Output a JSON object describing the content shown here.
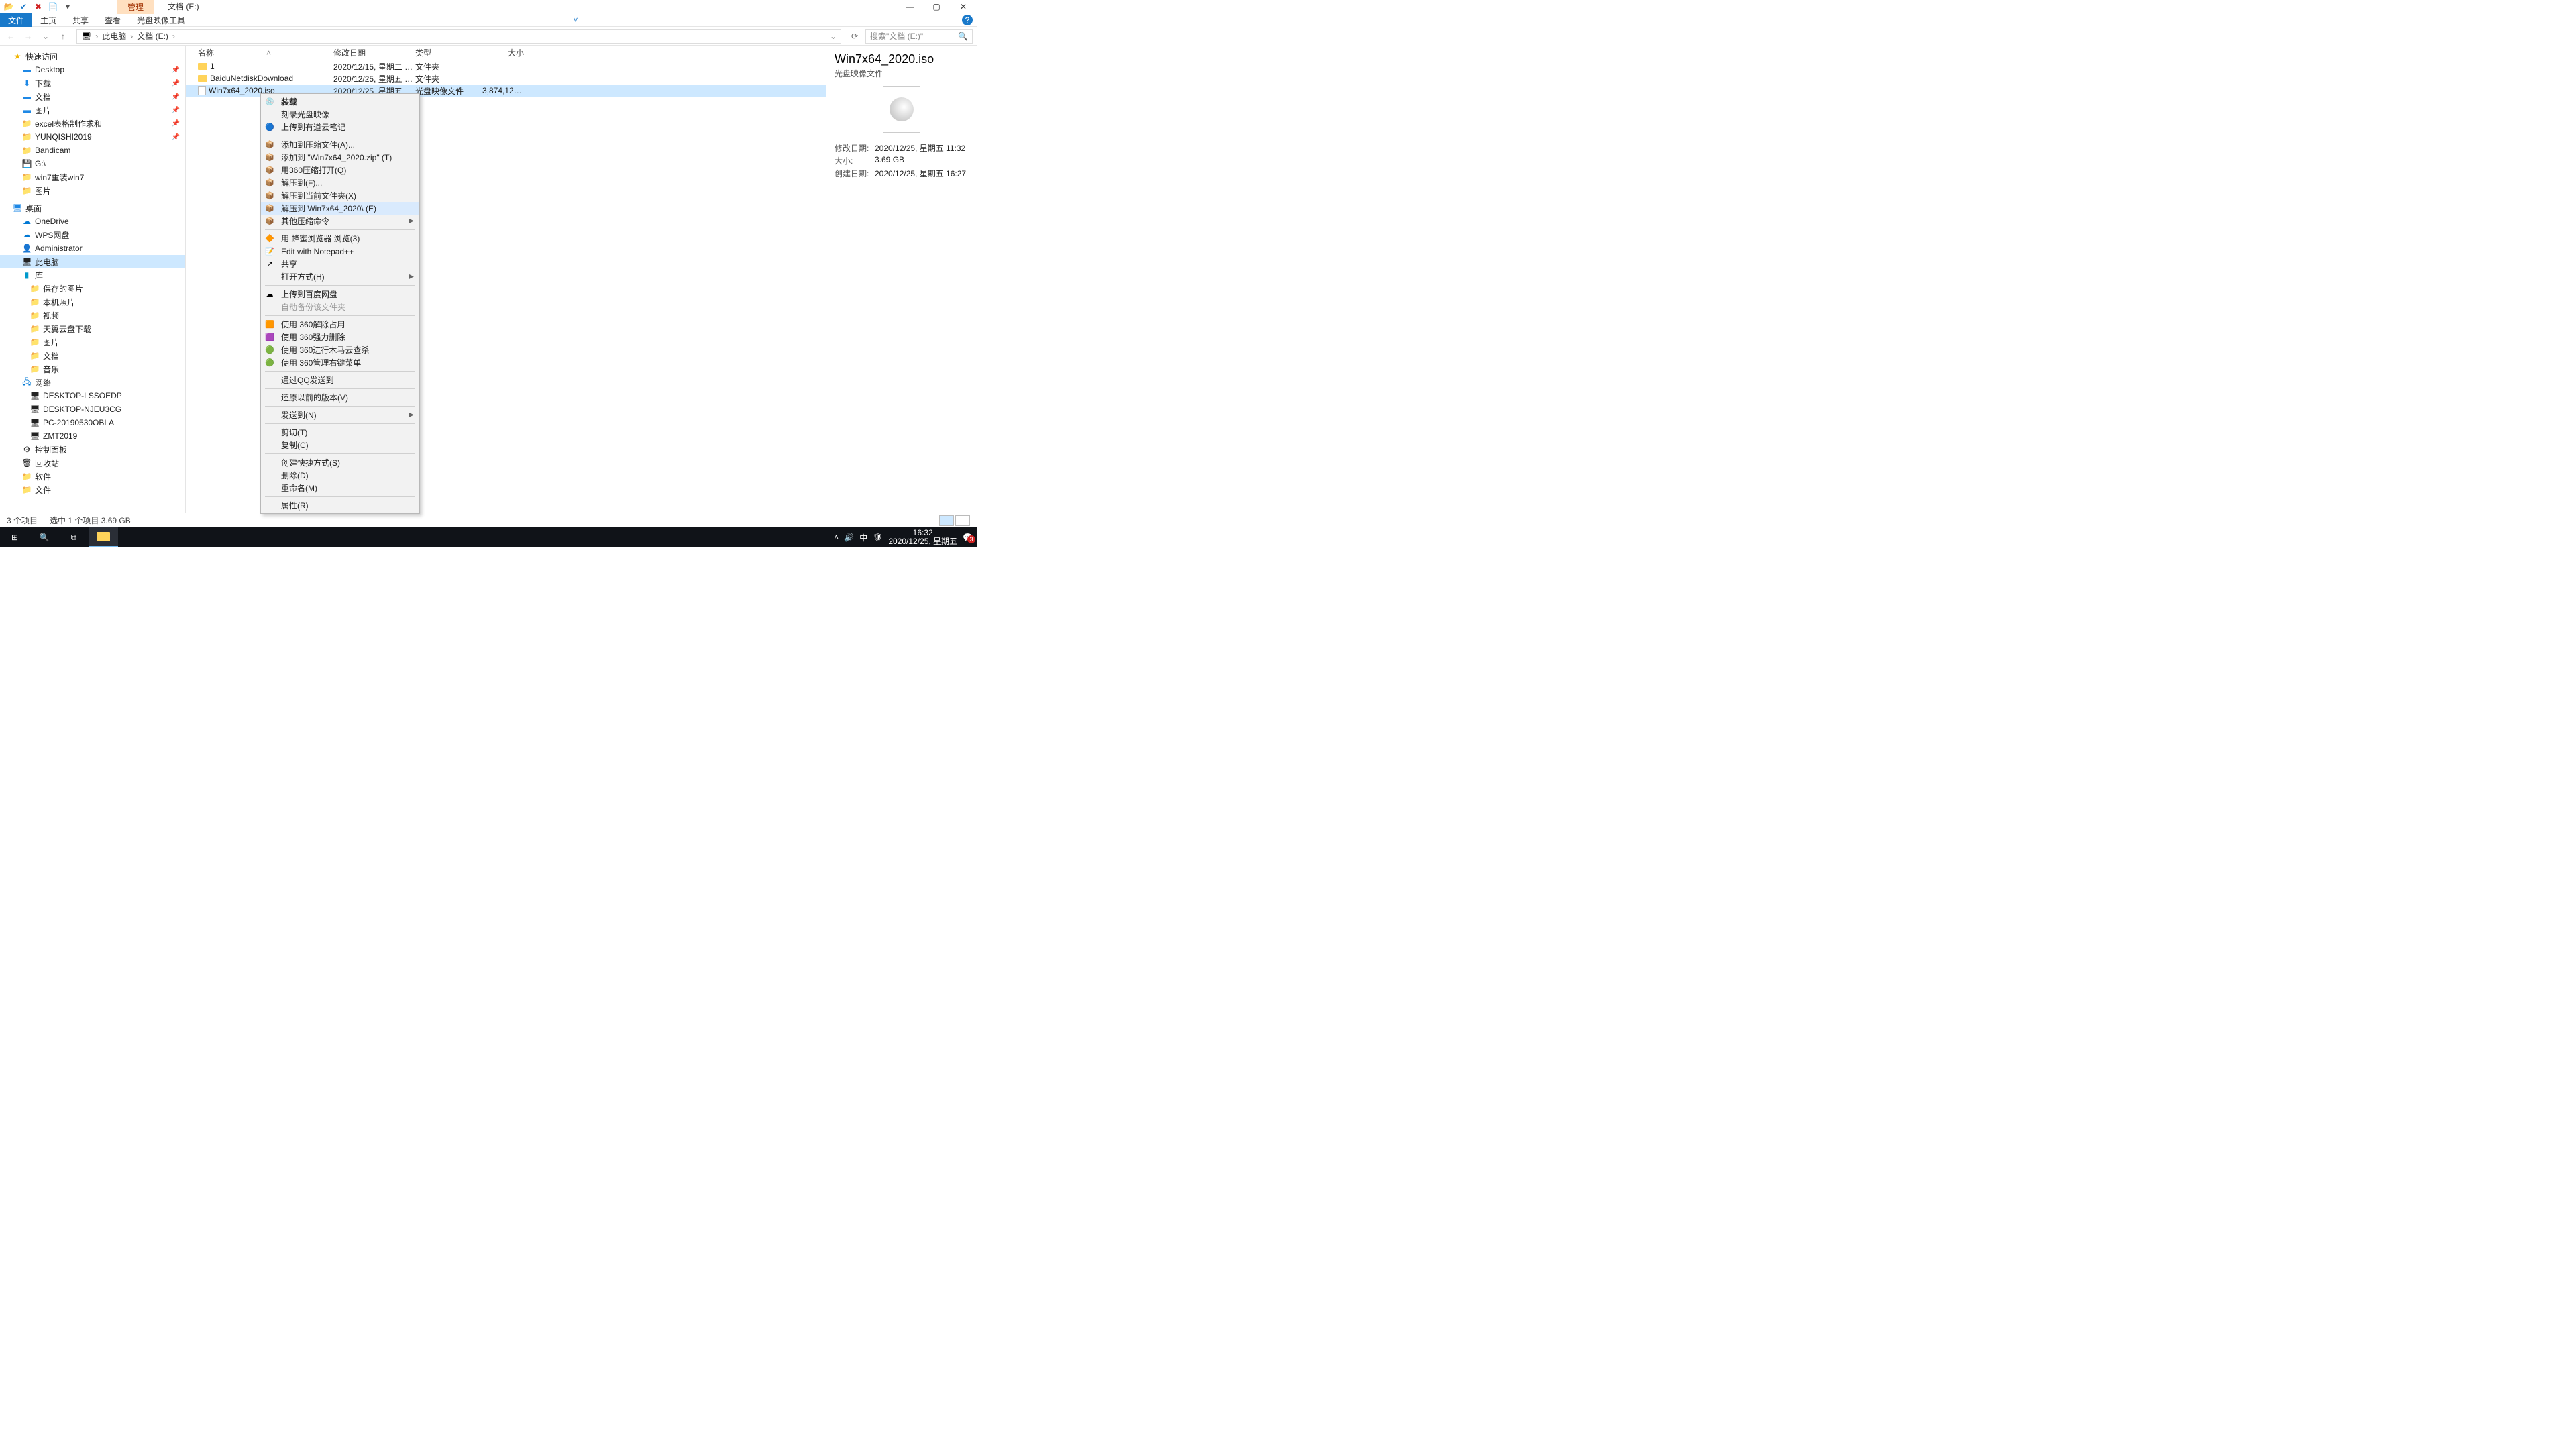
{
  "title_tab_manage": "管理",
  "window_title": "文档 (E:)",
  "qat": {
    "open": "📂",
    "check": "✔",
    "close": "✖",
    "new": "📄",
    "dropdown": "▾"
  },
  "ribbon": {
    "file": "文件",
    "home": "主页",
    "share": "共享",
    "view": "查看",
    "iso_tool": "光盘映像工具"
  },
  "win": {
    "min": "—",
    "max": "▢",
    "close": "✕",
    "help": "?"
  },
  "addr": {
    "back": "←",
    "forward": "→",
    "up": "↑",
    "recent": "⌄",
    "pc_icon": "🖥",
    "this_pc": "此电脑",
    "drive": "文档 (E:)",
    "sep": "›",
    "refresh": "⟳",
    "search_placeholder": "搜索\"文档 (E:)\"",
    "search_icon": "🔍",
    "history": "⌄"
  },
  "headers": {
    "name": "名称",
    "date": "修改日期",
    "type": "类型",
    "size": "大小",
    "sort": "˄"
  },
  "rows": [
    {
      "name": "1",
      "date": "2020/12/15, 星期二 1...",
      "type": "文件夹",
      "size": "",
      "kind": "folder"
    },
    {
      "name": "BaiduNetdiskDownload",
      "date": "2020/12/25, 星期五 1...",
      "type": "文件夹",
      "size": "",
      "kind": "folder"
    },
    {
      "name": "Win7x64_2020.iso",
      "date": "2020/12/25, 星期五 1...",
      "type": "光盘映像文件",
      "size": "3,874,126...",
      "kind": "file"
    }
  ],
  "tree": {
    "quick": "快速访问",
    "desktop": "Desktop",
    "download": "下载",
    "docs": "文档",
    "pics": "图片",
    "excel": "excel表格制作求和",
    "yunqishi": "YUNQISHI2019",
    "bandicam": "Bandicam",
    "gdrive": "G:\\",
    "win7": "win7重装win7",
    "pics2": "图片",
    "desk_root": "桌面",
    "onedrive": "OneDrive",
    "wps": "WPS网盘",
    "admin": "Administrator",
    "this_pc": "此电脑",
    "lib": "库",
    "saved_pics": "保存的图片",
    "local_pics": "本机照片",
    "video": "视频",
    "tianyi": "天翼云盘下载",
    "pics3": "图片",
    "docs2": "文档",
    "music": "音乐",
    "network": "网络",
    "pc1": "DESKTOP-LSSOEDP",
    "pc2": "DESKTOP-NJEU3CG",
    "pc3": "PC-20190530OBLA",
    "pc4": "ZMT2019",
    "cpanel": "控制面板",
    "recycle": "回收站",
    "soft": "软件",
    "files": "文件"
  },
  "details": {
    "title": "Win7x64_2020.iso",
    "subtitle": "光盘映像文件",
    "mdate_label": "修改日期:",
    "mdate": "2020/12/25, 星期五 11:32",
    "size_label": "大小:",
    "size": "3.69 GB",
    "cdate_label": "创建日期:",
    "cdate": "2020/12/25, 星期五 16:27"
  },
  "cm": [
    {
      "label": "装载",
      "icon": "💿",
      "bold": true
    },
    {
      "label": "刻录光盘映像",
      "icon": ""
    },
    {
      "label": "上传到有道云笔记",
      "icon": "🔵"
    },
    {
      "sep": true
    },
    {
      "label": "添加到压缩文件(A)...",
      "icon": "📦"
    },
    {
      "label": "添加到 \"Win7x64_2020.zip\" (T)",
      "icon": "📦"
    },
    {
      "label": "用360压缩打开(Q)",
      "icon": "📦"
    },
    {
      "label": "解压到(F)...",
      "icon": "📦"
    },
    {
      "label": "解压到当前文件夹(X)",
      "icon": "📦"
    },
    {
      "label": "解压到 Win7x64_2020\\ (E)",
      "icon": "📦",
      "hover": true
    },
    {
      "label": "其他压缩命令",
      "icon": "📦",
      "submenu": true
    },
    {
      "sep": true
    },
    {
      "label": "用 蜂蜜浏览器 浏览(3)",
      "icon": "🔶"
    },
    {
      "label": "Edit with Notepad++",
      "icon": "📝"
    },
    {
      "label": "共享",
      "icon": "↗"
    },
    {
      "label": "打开方式(H)",
      "icon": "",
      "submenu": true
    },
    {
      "sep": true
    },
    {
      "label": "上传到百度网盘",
      "icon": "☁"
    },
    {
      "label": "自动备份该文件夹",
      "icon": "",
      "disabled": true
    },
    {
      "sep": true
    },
    {
      "label": "使用 360解除占用",
      "icon": "🟧"
    },
    {
      "label": "使用 360强力删除",
      "icon": "🟪"
    },
    {
      "label": "使用 360进行木马云查杀",
      "icon": "🟢"
    },
    {
      "label": "使用 360管理右键菜单",
      "icon": "🟢"
    },
    {
      "sep": true
    },
    {
      "label": "通过QQ发送到",
      "icon": ""
    },
    {
      "sep": true
    },
    {
      "label": "还原以前的版本(V)",
      "icon": ""
    },
    {
      "sep": true
    },
    {
      "label": "发送到(N)",
      "icon": "",
      "submenu": true
    },
    {
      "sep": true
    },
    {
      "label": "剪切(T)",
      "icon": ""
    },
    {
      "label": "复制(C)",
      "icon": ""
    },
    {
      "sep": true
    },
    {
      "label": "创建快捷方式(S)",
      "icon": ""
    },
    {
      "label": "删除(D)",
      "icon": ""
    },
    {
      "label": "重命名(M)",
      "icon": ""
    },
    {
      "sep": true
    },
    {
      "label": "属性(R)",
      "icon": ""
    }
  ],
  "status": {
    "count": "3 个项目",
    "selected": "选中 1 个项目  3.69 GB"
  },
  "taskbar": {
    "start": "⊞",
    "search": "🔍",
    "taskview": "⧉",
    "tray_up": "˄",
    "sound": "🔊",
    "ime": "中",
    "notif": "💬",
    "badge": "3",
    "time": "16:32",
    "date": "2020/12/25, 星期五"
  }
}
